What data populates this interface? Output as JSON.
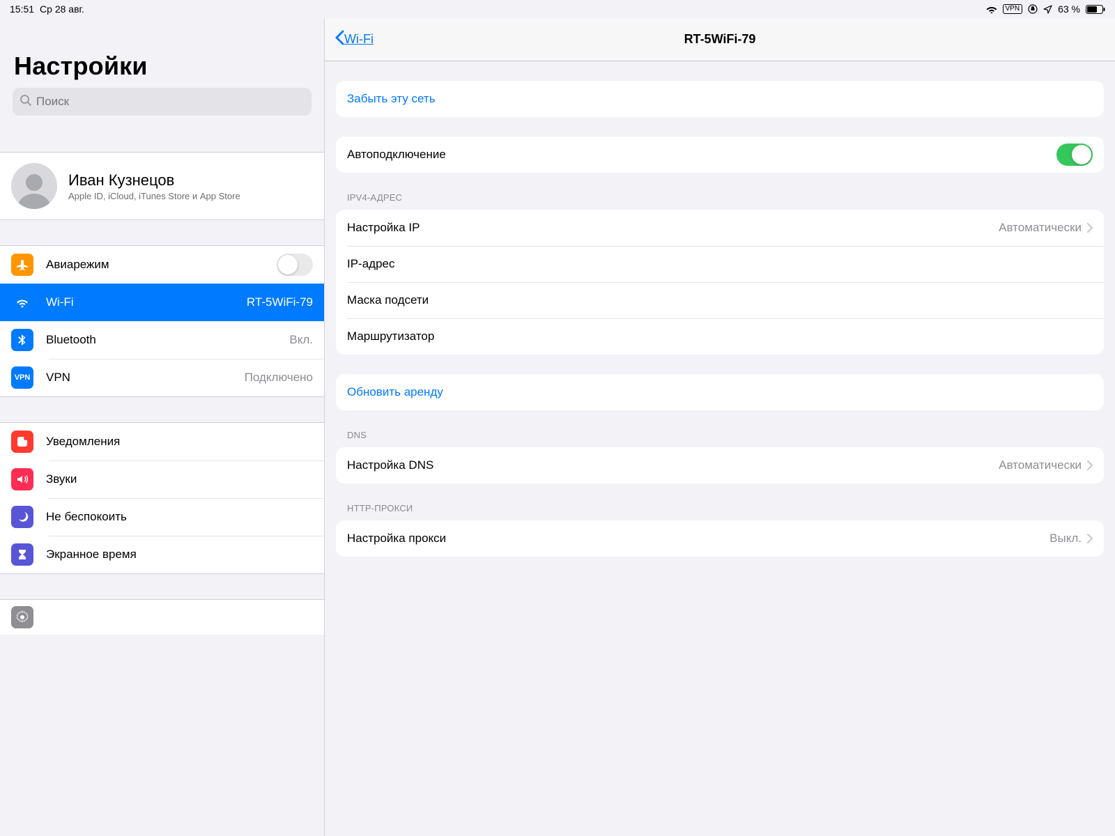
{
  "statusbar": {
    "time": "15:51",
    "date": "Ср 28 авг.",
    "vpn_label": "VPN",
    "battery_pct": "63 %"
  },
  "sidebar": {
    "title": "Настройки",
    "search_placeholder": "Поиск",
    "profile": {
      "name": "Иван Кузнецов",
      "subtitle": "Apple ID, iCloud, iTunes Store и App Store"
    },
    "group1": {
      "airplane": "Авиарежим",
      "wifi_label": "Wi-Fi",
      "wifi_value": "RT-5WiFi-79",
      "bluetooth_label": "Bluetooth",
      "bluetooth_value": "Вкл.",
      "vpn_label": "VPN",
      "vpn_value": "Подключено"
    },
    "group2": {
      "notifications": "Уведомления",
      "sounds": "Звуки",
      "dnd": "Не беспокоить",
      "screentime": "Экранное время"
    }
  },
  "detail": {
    "back_label": "Wi-Fi",
    "title": "RT-5WiFi-79",
    "forget": "Забыть эту сеть",
    "autojoin": "Автоподключение",
    "ipv4_header": "IPV4-АДРЕС",
    "ip_config_label": "Настройка IP",
    "ip_config_value": "Автоматически",
    "ip_address": "IP-адрес",
    "subnet": "Маска подсети",
    "router": "Маршрутизатор",
    "renew": "Обновить аренду",
    "dns_header": "DNS",
    "dns_label": "Настройка DNS",
    "dns_value": "Автоматически",
    "proxy_header": "HTTP-ПРОКСИ",
    "proxy_label": "Настройка прокси",
    "proxy_value": "Выкл."
  }
}
